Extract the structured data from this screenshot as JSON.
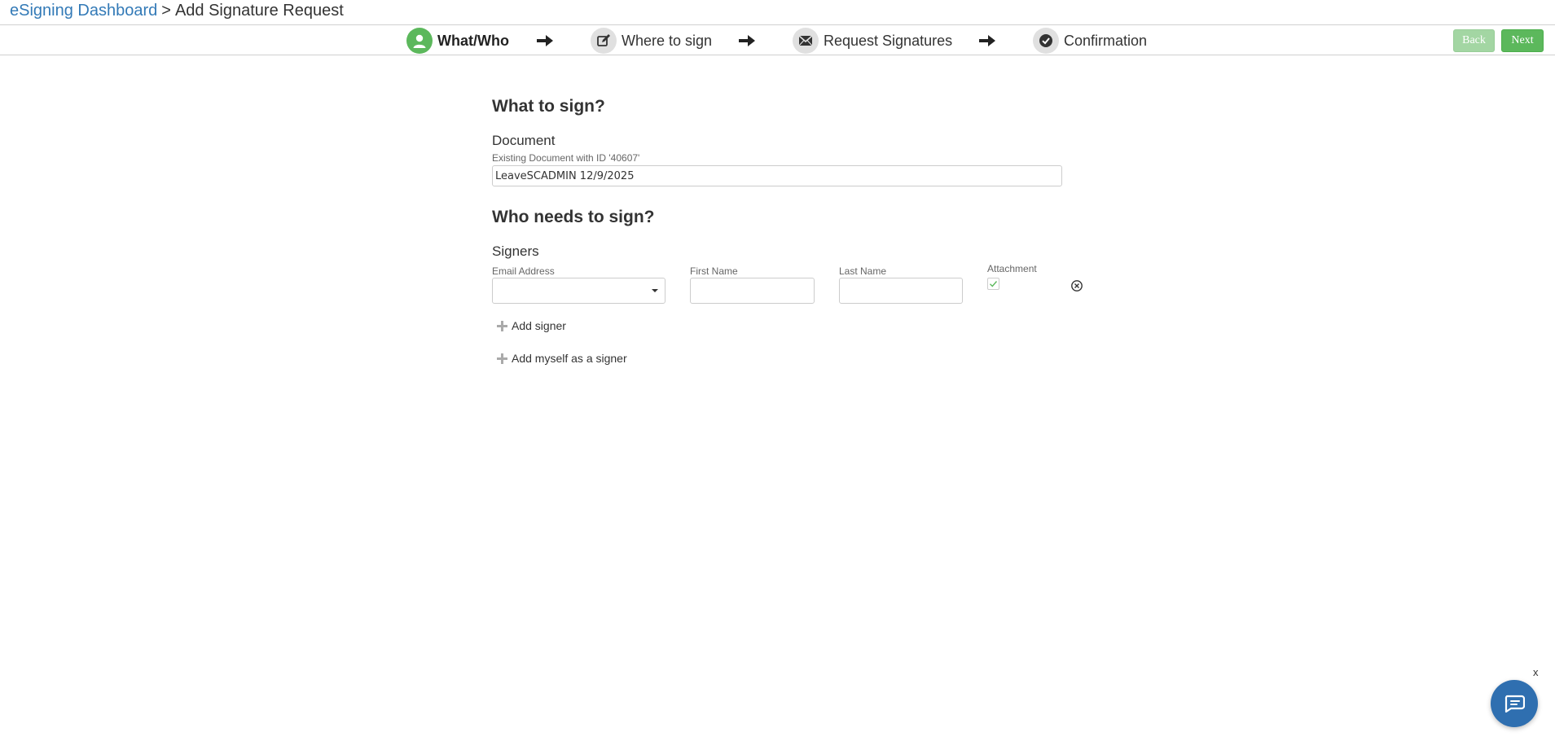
{
  "breadcrumb": {
    "dashboard_link": "eSigning Dashboard",
    "separator": ">",
    "current_page": "Add Signature Request"
  },
  "wizard": {
    "steps": [
      {
        "label": "What/Who",
        "icon": "user-icon",
        "active": true
      },
      {
        "label": "Where to sign",
        "icon": "edit-icon",
        "active": false
      },
      {
        "label": "Request Signatures",
        "icon": "envelope-icon",
        "active": false
      },
      {
        "label": "Confirmation",
        "icon": "check-circle-icon",
        "active": false
      }
    ],
    "back_label": "Back",
    "next_label": "Next"
  },
  "what_section": {
    "title": "What to sign?",
    "document_label": "Document",
    "document_hint": "Existing Document with ID '40607'",
    "document_value": "LeaveSCADMIN 12/9/2025"
  },
  "who_section": {
    "title": "Who needs to sign?",
    "signers_label": "Signers",
    "columns": {
      "email": "Email Address",
      "first_name": "First Name",
      "last_name": "Last Name",
      "attachment": "Attachment"
    },
    "signer_row": {
      "email": "",
      "first_name": "",
      "last_name": "",
      "attachment_checked": true
    },
    "add_signer_label": "Add signer",
    "add_myself_label": "Add myself as a signer"
  },
  "chat": {
    "close_label": "x"
  },
  "colors": {
    "accent_green": "#5cb85c",
    "link_blue": "#337ab7",
    "chat_blue": "#2f6fb0"
  }
}
